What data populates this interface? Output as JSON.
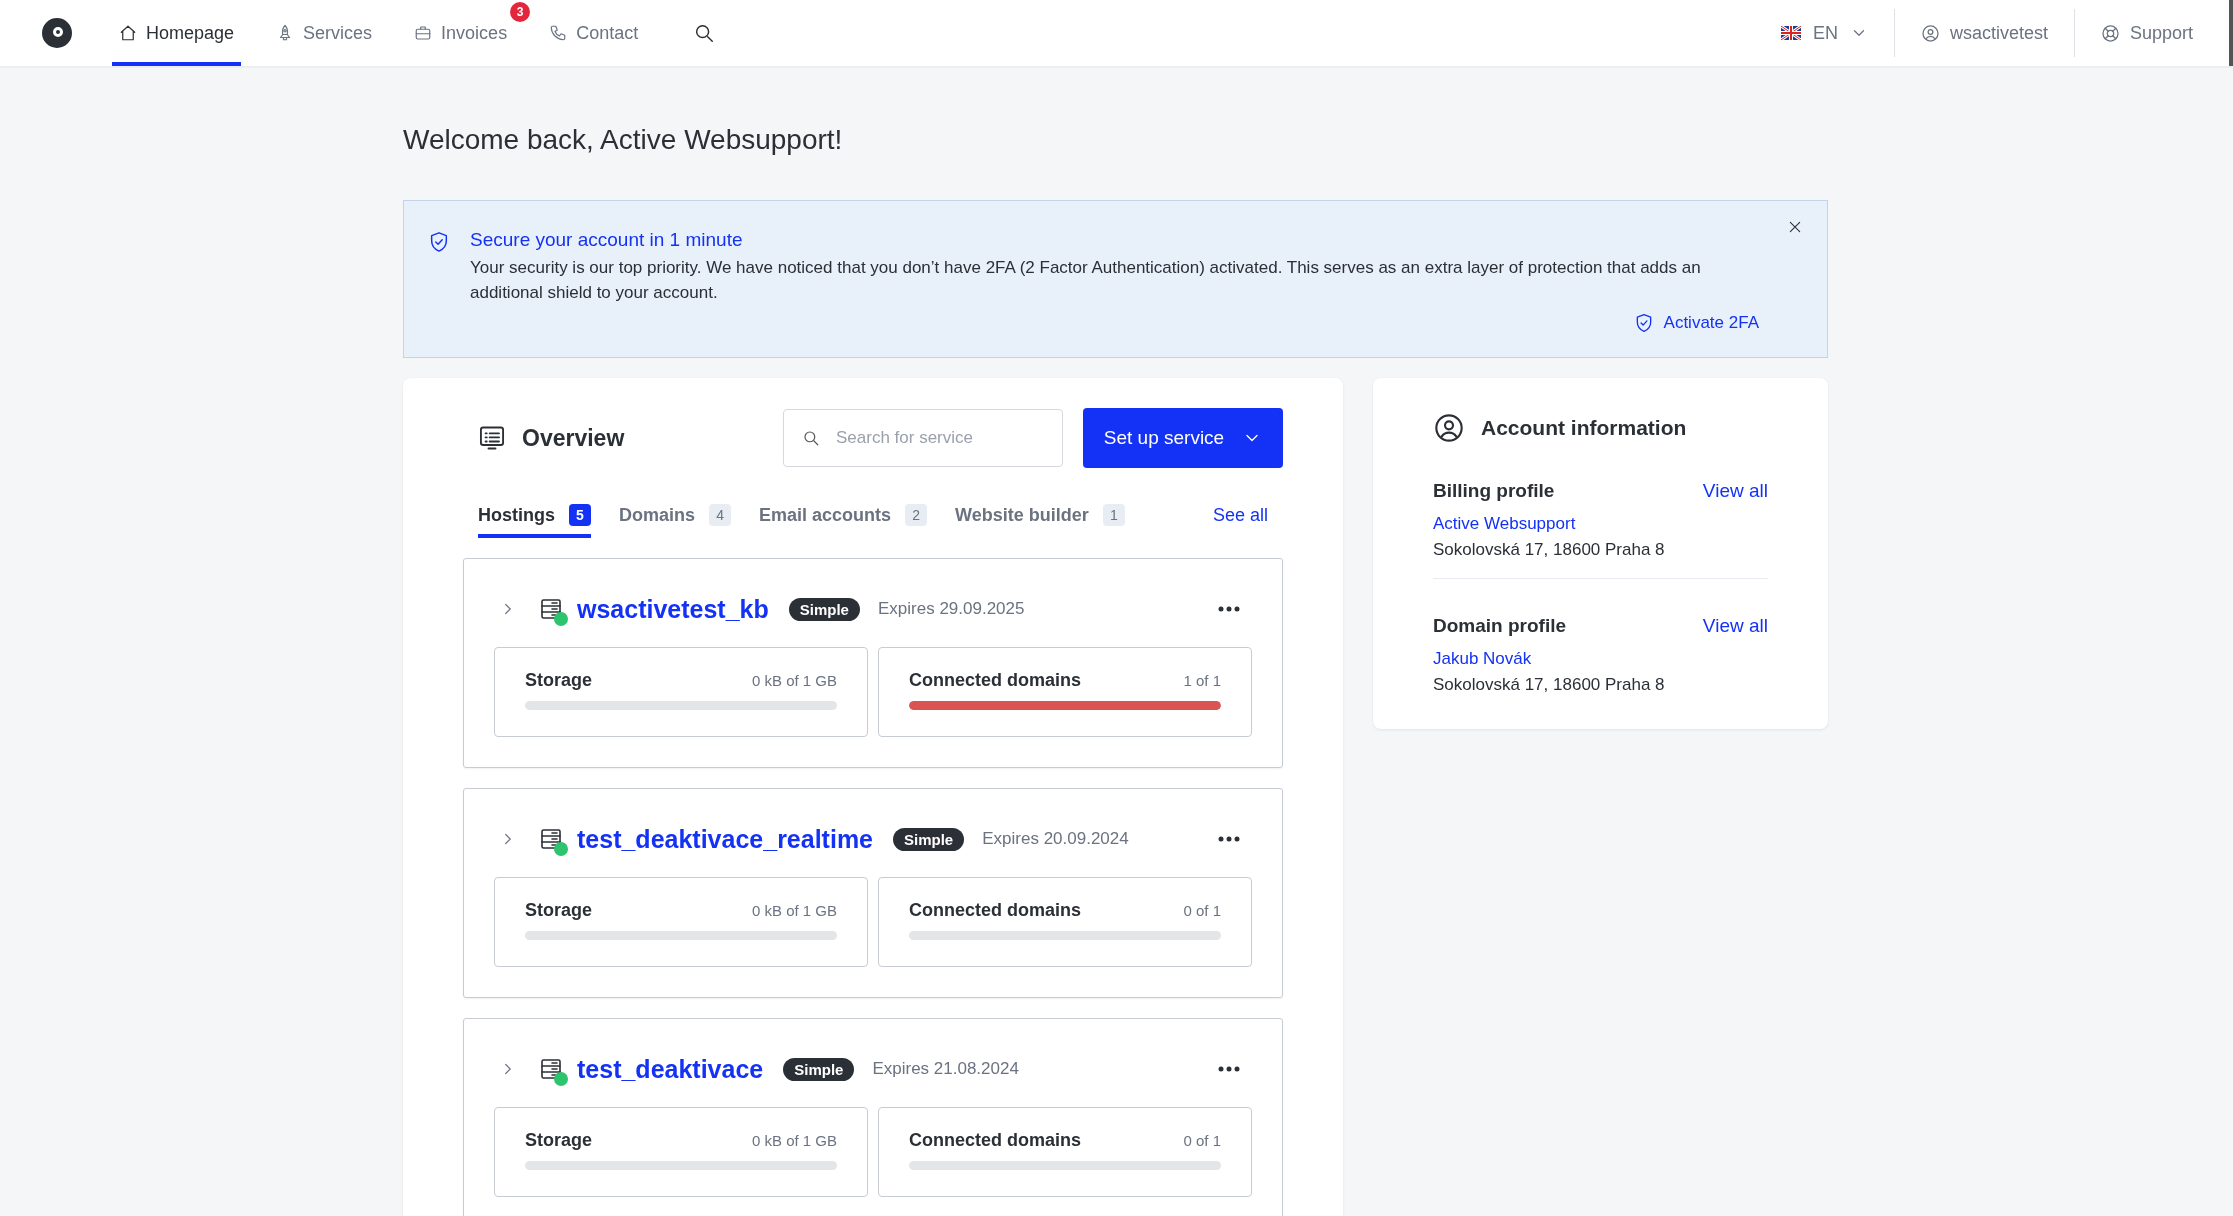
{
  "nav": {
    "items": [
      {
        "label": "Homepage",
        "selected": true
      },
      {
        "label": "Services",
        "selected": false
      },
      {
        "label": "Invoices",
        "selected": false,
        "badge": "3"
      },
      {
        "label": "Contact",
        "selected": false
      }
    ],
    "language": "EN",
    "user": "wsactivetest",
    "support": "Support"
  },
  "welcome": "Welcome back, Active Websupport!",
  "banner": {
    "title": "Secure your account in 1 minute",
    "text": "Your security is our top priority. We have noticed that you don’t have 2FA (2 Factor Authentication) activated. This serves as an extra layer of protection that adds an additional shield to your account.",
    "action": "Activate 2FA"
  },
  "overview": {
    "title": "Overview",
    "search": {
      "placeholder": "Search for service"
    },
    "button": "Set up service",
    "tabs": [
      {
        "label": "Hostings",
        "count": "5",
        "selected": true
      },
      {
        "label": "Domains",
        "count": "4",
        "selected": false
      },
      {
        "label": "Email accounts",
        "count": "2",
        "selected": false
      },
      {
        "label": "Website builder",
        "count": "1",
        "selected": false
      }
    ],
    "see_all": "See all",
    "hostings": [
      {
        "name": "wsactivetest_kb",
        "plan": "Simple",
        "expires": "Expires 29.09.2025",
        "metrics": [
          {
            "label": "Storage",
            "reading": "0 kB of 1 GB",
            "level": 0
          },
          {
            "label": "Connected domains",
            "reading": "1 of 1",
            "level": 1
          }
        ]
      },
      {
        "name": "test_deaktivace_realtime",
        "plan": "Simple",
        "expires": "Expires 20.09.2024",
        "metrics": [
          {
            "label": "Storage",
            "reading": "0 kB of 1 GB",
            "level": 0
          },
          {
            "label": "Connected domains",
            "reading": "0 of 1",
            "level": 0
          }
        ]
      },
      {
        "name": "test_deaktivace",
        "plan": "Simple",
        "expires": "Expires 21.08.2024",
        "metrics": [
          {
            "label": "Storage",
            "reading": "0 kB of 1 GB",
            "level": 0
          },
          {
            "label": "Connected domains",
            "reading": "0 of 1",
            "level": 0
          }
        ]
      }
    ]
  },
  "account": {
    "title": "Account information",
    "sections": [
      {
        "title": "Billing profile",
        "link": "View all",
        "name": "Active Websupport",
        "address": "Sokolovská 17, 18600 Praha 8"
      },
      {
        "title": "Domain profile",
        "link": "View all",
        "name": "Jakub Novák",
        "address": "Sokolovská 17, 18600 Praha 8"
      }
    ]
  }
}
